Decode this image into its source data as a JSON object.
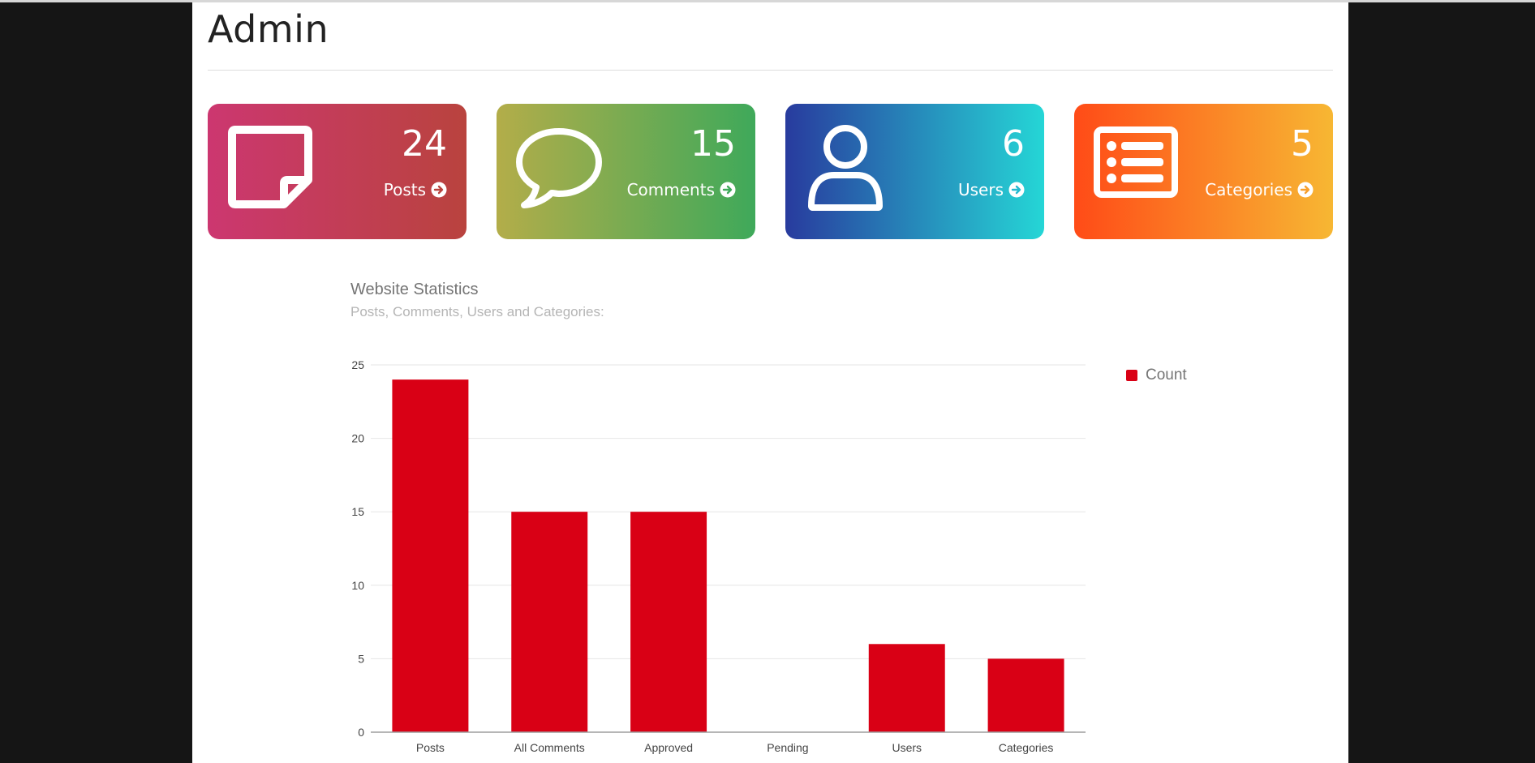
{
  "page": {
    "title": "Admin"
  },
  "cards": [
    {
      "count": "24",
      "label": "Posts",
      "icon": "note-icon"
    },
    {
      "count": "15",
      "label": "Comments",
      "icon": "comment-icon"
    },
    {
      "count": "6",
      "label": "Users",
      "icon": "user-icon"
    },
    {
      "count": "5",
      "label": "Categories",
      "icon": "list-icon"
    }
  ],
  "chart": {
    "title": "Website Statistics",
    "subtitle": "Posts, Comments, Users and Categories:"
  },
  "colors": {
    "bar": "#d90015",
    "grid": "#e6e6e6",
    "axis": "#9e9e9e"
  },
  "chart_data": {
    "type": "bar",
    "title": "Website Statistics",
    "subtitle": "Posts, Comments, Users and Categories:",
    "categories": [
      "Posts",
      "All Comments",
      "Approved",
      "Pending",
      "Users",
      "Categories"
    ],
    "series": [
      {
        "name": "Count",
        "values": [
          24,
          15,
          15,
          0,
          6,
          5
        ]
      }
    ],
    "ylim": [
      0,
      25
    ],
    "yticks": [
      0,
      5,
      10,
      15,
      20,
      25
    ],
    "grid": true,
    "legend": "right",
    "xlabel": "",
    "ylabel": ""
  }
}
